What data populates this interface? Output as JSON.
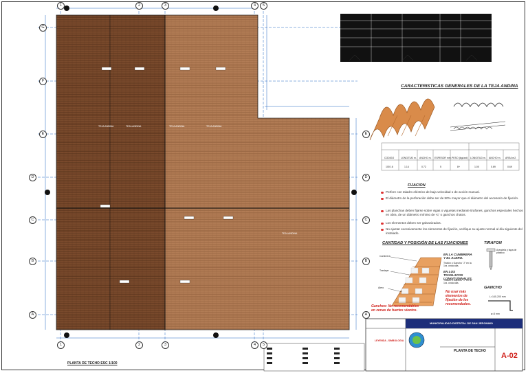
{
  "axes": {
    "cols": [
      "1",
      "2",
      "3",
      "4",
      "5"
    ],
    "rows": [
      "G",
      "F",
      "E",
      "D",
      "C",
      "B",
      "A"
    ]
  },
  "plan": {
    "roof_labels": [
      "TEJA ANDINA",
      "TEJA ANDINA",
      "TEJA ANDINA",
      "TEJA ANDINA",
      "TEJA ANDINA"
    ],
    "title": "PLANTA DE TECHO   ESC 1/100"
  },
  "specs": {
    "title": "CARACTERISTICAS GENERALES DE LA TEJA ANDINA",
    "table": {
      "headers": [
        "CODIGO",
        "LONGITUD m.",
        "ANCHO m.",
        "ESPESOR mm.",
        "PESO (kg/und)",
        "LONGITUD m.",
        "ANCHO m.",
        "AREA m2."
      ],
      "row": [
        "100 16",
        "1.14",
        "0.72",
        "5",
        "8+",
        "1.00",
        "0.69",
        "0.69"
      ]
    },
    "fixation_title": "FIJACION",
    "fixation_items": [
      "Perfore con taladro eléctrico de baja velocidad o de acción manual.",
      "El diámetro de la perforación debe ser de 50% mayor que el diámetro del accesorio de fijación.",
      "Las planchas deben fijarse sobre vigas o viguetas mediante tirafones, ganchos especiales hechos en obra, de un diámetro mínimo de ¼\" o ganchos chatos.",
      "Los elementos deben ser galvanizados.",
      "No ajustar excesivamente los elementos de fijación, verifique su ajuste normal al día siguiente del instalado."
    ],
    "fix_pos_title": "CANTIDAD Y POSICIÓN DE LAS FIJACIONES",
    "fix_pos_labels": [
      "Cumbrera",
      "Traslape",
      "Alero"
    ],
    "ridge_note": "EN LA CUMBRERA Y EL ALERO.",
    "ridge_sub": "Tirafón o Gancho \"J\" en la 1ra. onda alta.",
    "overlap_note": "EN LOS TRASLAPOS LONGITUDINALES.",
    "overlap_sub": "Tirafón o Gancho \"J\" en la 1ra. onda alta.",
    "warn": "No usar más elementos de fijación de los recomendados.",
    "hooks_note": "Ganchos: No recomendables en zonas de fuertes vientos.",
    "tirafon_title": "TIRAFON",
    "tirafon_desc": "Arandela y tapa de plástico",
    "gancho_title": "GANCHO",
    "gancho_dims": "L=140-200 mm",
    "gancho_d": "ø=3 mm"
  },
  "titleblock": {
    "municipality": "MUNICIPALIDAD DISTRITAL DE SAN JERONIMO",
    "project": "PLANTA DE TECHO",
    "sheet": "A-02",
    "legend_title": "LEYENDA - SIMBOLOGIA"
  },
  "colors": {
    "dark_roof": "#7a4a2c",
    "light_roof": "#b27c55",
    "grid": "#1e63c0",
    "accent": "#d0201b"
  }
}
